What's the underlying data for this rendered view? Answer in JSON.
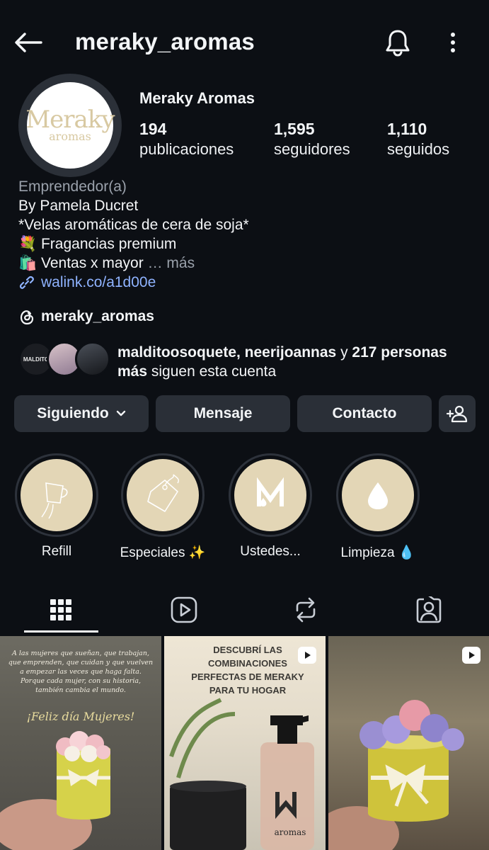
{
  "header": {
    "username": "meraky_aromas"
  },
  "profile": {
    "logo_main": "Meraky",
    "logo_sub": "aromas",
    "display_name": "Meraky Aromas",
    "stats": [
      {
        "value": "194",
        "label": "publicaciones"
      },
      {
        "value": "1,595",
        "label": "seguidores"
      },
      {
        "value": "1,110",
        "label": "seguidos"
      }
    ],
    "category": "Emprendedor(a)",
    "bio_lines": [
      "By Pamela Ducret",
      "*Velas aromáticas de cera de soja*",
      "💐 Fragancias premium",
      "🛍️ Ventas x mayor"
    ],
    "more": "… más",
    "link": "walink.co/a1d00e",
    "threads_handle": "meraky_aromas"
  },
  "mutual": {
    "names": "malditoosoquete, neerijoannas",
    "connector": " y ",
    "count_text": "217 personas más",
    "suffix": " siguen esta cuenta",
    "avatar_text": "MALDITO"
  },
  "actions": {
    "following": "Siguiendo",
    "message": "Mensaje",
    "contact": "Contacto"
  },
  "highlights": [
    {
      "label": "Refill"
    },
    {
      "label": "Especiales ✨"
    },
    {
      "label": "Ustedes..."
    },
    {
      "label": "Limpieza 💧"
    }
  ],
  "posts": {
    "p1_quote": "A las mujeres que sueñan, que trabajan, que emprenden, que cuidan y que vuelven a empezar las veces que haga falta. Porque cada mujer, con su historia, también cambia el mundo.",
    "p1_title": "¡Feliz día Mujeres!",
    "p2_title": "DESCUBRÍ LAS COMBINACIONES PERFECTAS DE MERAKY PARA TU HOGAR",
    "p2_brand": "aromas"
  },
  "colors": {
    "background": "#0c0f14",
    "button": "#2a2f37",
    "link": "#8fb3ff",
    "highlight_bg": "#e3d6b6"
  }
}
